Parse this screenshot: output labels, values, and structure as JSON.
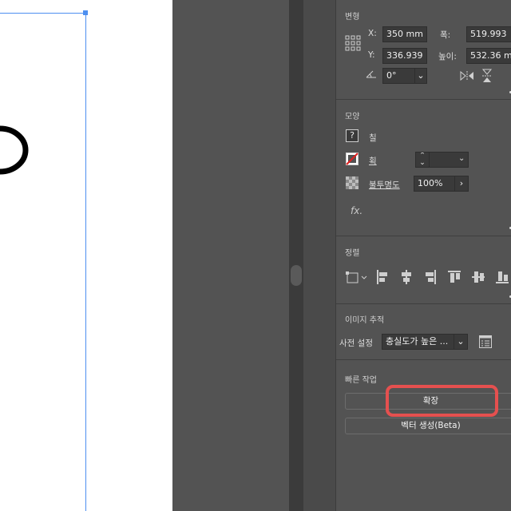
{
  "transform": {
    "title": "변형",
    "x_label": "X:",
    "x_value": "350 mm",
    "y_label": "Y:",
    "y_value": "336.939",
    "width_label": "폭:",
    "width_value": "519.993",
    "height_label": "높이:",
    "height_value": "532.36 m",
    "angle_value": "0°"
  },
  "appearance": {
    "title": "모양",
    "fill_label": "칠",
    "stroke_label": "획",
    "opacity_label": "불투명도",
    "opacity_value": "100%",
    "fx_label": "fx."
  },
  "align": {
    "title": "정렬"
  },
  "image_trace": {
    "title": "이미지 추적",
    "preset_label": "사전 설정",
    "preset_value": "충실도가 높은 ..."
  },
  "quick_actions": {
    "title": "빠른 작업",
    "expand_label": "확장",
    "vector_label": "벡터 생성(Beta)"
  },
  "colors": {
    "highlight": "#e5504f",
    "artboard_guide": "#4d8ff0",
    "panel_bg": "#535353"
  }
}
